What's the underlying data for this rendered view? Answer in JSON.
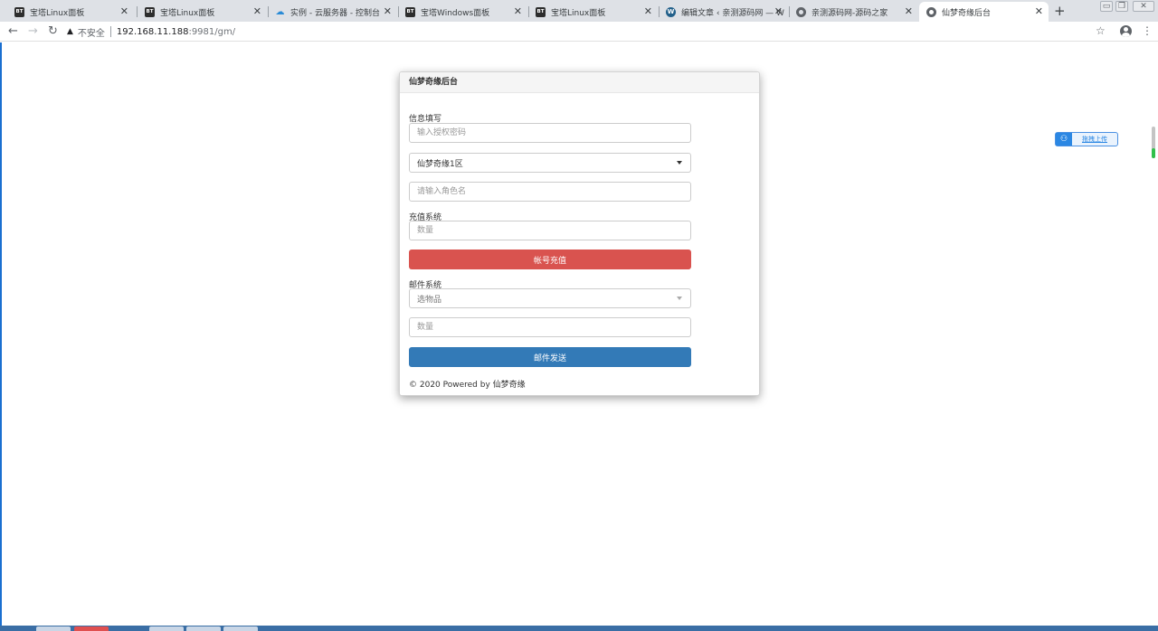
{
  "browser": {
    "tabs": [
      {
        "title": "宝塔Linux面板",
        "favicon": "bt-icon",
        "fav_text": "BT"
      },
      {
        "title": "宝塔Linux面板",
        "favicon": "bt-icon",
        "fav_text": "BT"
      },
      {
        "title": "实例 - 云服务器 - 控制台",
        "favicon": "cloud-icon",
        "fav_text": "☁"
      },
      {
        "title": "宝塔Windows面板",
        "favicon": "bt-icon",
        "fav_text": "BT"
      },
      {
        "title": "宝塔Linux面板",
        "favicon": "bt-icon",
        "fav_text": "BT"
      },
      {
        "title": "编辑文章 ‹ 亲测源码网 — W",
        "favicon": "wordpress-icon",
        "fav_text": "W"
      },
      {
        "title": "亲测源码网-源码之家",
        "favicon": "globe-icon",
        "fav_text": ""
      },
      {
        "title": "仙梦奇缘后台",
        "favicon": "globe-icon",
        "fav_text": "",
        "active": true
      }
    ],
    "new_tab_symbol": "+",
    "close_symbol": "✕",
    "address": {
      "security_label": "不安全",
      "host": "192.168.11.188",
      "path": ":9981/gm/"
    }
  },
  "panel": {
    "title": "仙梦奇缘后台",
    "info_section_label": "信息填写",
    "password_placeholder": "输入授权密码",
    "server_selected": "仙梦奇缘1区",
    "role_placeholder": "请输入角色名",
    "recharge_section_label": "充值系统",
    "recharge_amount_placeholder": "数量",
    "recharge_button": "帐号充值",
    "mail_section_label": "邮件系统",
    "item_select_placeholder": "选物品",
    "mail_amount_placeholder": "数量",
    "mail_button": "邮件发送",
    "footer": "© 2020 Powered by 仙梦奇缘"
  },
  "upload_widget": {
    "label": "拖拽上传"
  },
  "colors": {
    "recharge_button": "#d9534f",
    "mail_button": "#337ab7",
    "tabstrip": "#dee1e6"
  }
}
